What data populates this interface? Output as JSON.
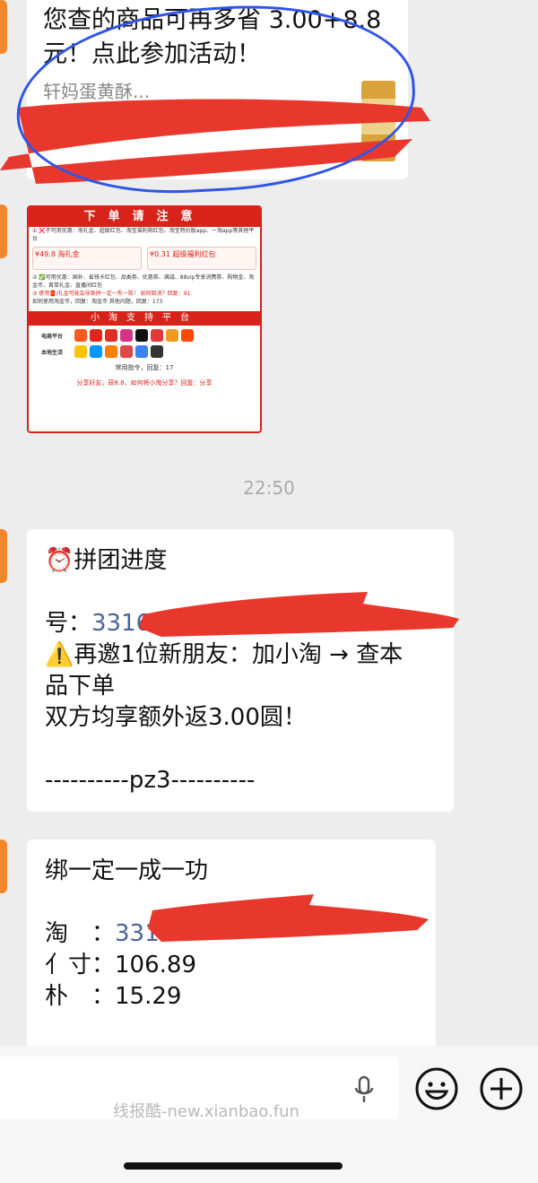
{
  "messages": {
    "promo": {
      "line1": "您查的商品可再多省 3.00+8.8",
      "line2": "元！点此参加活动！",
      "sub": "轩妈蛋黄酥..."
    },
    "poster": {
      "title": "下单请注意",
      "row1": "① ❌不可用优惠：淘礼金、超级红包、淘宝福利购红包、淘宝特价版app、一淘app等其他平台",
      "card1": "¥49.8 淘礼金",
      "card2": "¥0.31 超级福利红包",
      "row2": "② ✅可用优惠：国补、省钱卡红包、品类券、优惠券、满减、88vip专享消费券、购物金、淘金币、首单礼金、直播间红包",
      "row3": "③ 使用🧧/礼金可能会导致拼一定一失一败！ 如何取消？回复：91",
      "row4": "如何使用淘金币，回复：淘金币    其他问题，回复：173",
      "section2": "小淘支持平台",
      "ecom_label": "电商平台",
      "local_label": "本地生活",
      "footer1": "常用指令，回复：17",
      "footer2": "分享好友，获8.8，如何将小淘分享？回复：分享"
    },
    "time": "22:50",
    "group": {
      "title": "⏰拼团进度",
      "id_label": "号：",
      "id_value": "331645...",
      "invite_line1": "⚠️再邀1位新朋友：加小淘 → 查本",
      "invite_line2": "品下单",
      "reward": "双方均享额外返3.00圆！",
      "divider": "----------pz3----------"
    },
    "bind": {
      "title": "绑一定一成一功",
      "tao_label": "淘　：",
      "tao_value": "331...",
      "size_label": "亻寸：",
      "size_value": "106.89",
      "pu_label": "朴　：",
      "pu_value": "15.29"
    }
  },
  "input": {
    "watermark": "线报酷-new.xianbao.fun"
  },
  "colors": {
    "accent_red": "#d8231b",
    "link_blue": "#4a6596",
    "avatar_orange": "#f2862b",
    "scribble_red": "#e8382e",
    "oval_blue": "#2f55e8"
  }
}
